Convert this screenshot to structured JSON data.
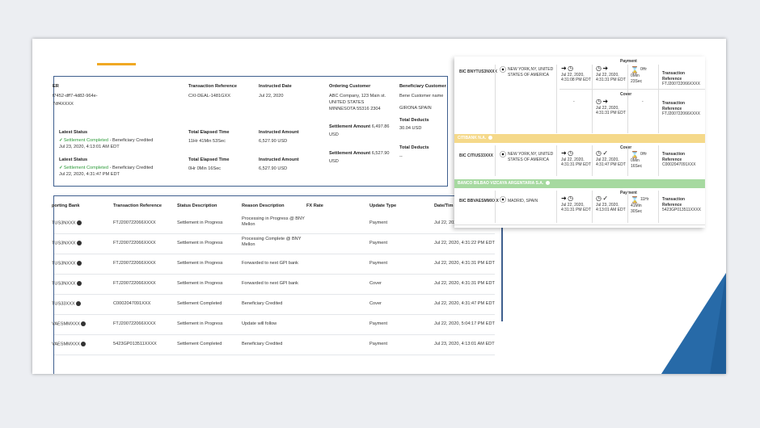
{
  "summary": {
    "ref_label_partial": "ER",
    "ref_value_1": "f7452-dff7-4d82-964e-",
    "ref_value_2": "7df4XXXX",
    "txn_ref_label": "Transaction Reference",
    "txn_ref_value": "CXI-DEAL-1481GXX",
    "instructed_date_label": "Instructed Date",
    "instructed_date_value": "Jul 22, 2020",
    "ordering_label": "Ordering Customer",
    "ordering_line1": "ABC Company, 123 Main st.",
    "ordering_line2": "UNITED STATES",
    "ordering_line3": "MINNESOTA 55316 2304",
    "beneficiary_label": "Beneficiary Customer",
    "beneficiary_line1": "Bene Customer name",
    "beneficiary_line2": "GIRONA SPAIN",
    "status1_label": "Latest Status",
    "status1_text": "Settlement Completed",
    "status1_suffix": " - Beneficiary Credited",
    "status1_date": "Jul 23, 2020, 4:13:01 AM EDT",
    "elapsed1_label": "Total Elapsed Time",
    "elapsed1_value": "11Hr 41Min 53Sec",
    "amount1_label": "Instructed Amount",
    "amount1_value": "6,527.90 USD",
    "settle1_label": "Settlement Amount",
    "settle1_value": "6,497.86",
    "settle1_ccy": "USD",
    "deducts1_label": "Total Deducts",
    "deducts1_value": "30.04 USD",
    "status2_label": "Latest Status",
    "status2_text": "Settlement Completed",
    "status2_suffix": " - Beneficiary Credited",
    "status2_date": "Jul 22, 2020, 4:31:47 PM EDT",
    "elapsed2_label": "Total Elapsed Time",
    "elapsed2_value": "0Hr 0Min 16Sec",
    "amount2_label": "Instructed Amount",
    "amount2_value": "6,527.90 USD",
    "settle2_label": "Settlement Amount",
    "settle2_value": "6,527.90",
    "settle2_ccy": "USD",
    "deducts2_label": "Total Deducts",
    "deducts2_value": "--"
  },
  "table": {
    "headers": [
      "porting Bank",
      "Transaction Reference",
      "Status Description",
      "Reason Description",
      "FX Rate",
      "Update Type",
      "Date/Tim"
    ],
    "rows": [
      {
        "bank": "TUS3NXXX",
        "ref": "FTJ200722066XXXX",
        "status": "Settlement in Progress",
        "reason1": "Processing in Progress @ BNY",
        "reason2": "Mellon",
        "type": "Payment",
        "date": "Jul 22, 2020,"
      },
      {
        "bank": "TUS3NXXX",
        "ref": "FTJ200722066XXXX",
        "status": "Settlement in Progress",
        "reason1": "Processing Complete @ BNY",
        "reason2": "Mellon",
        "type": "Payment",
        "date": "Jul 22, 2020, 4:31:22 PM EDT"
      },
      {
        "bank": "TUS3NXXX",
        "ref": "FTJ200722066XXXX",
        "status": "Settlement in Progress",
        "reason1": "Forwarded to next GPI bank",
        "reason2": "",
        "type": "Payment",
        "date": "Jul 22, 2020, 4:31:31 PM EDT"
      },
      {
        "bank": "TUS3NXXX",
        "ref": "FTJ200722066XXXX",
        "status": "Settlement in Progress",
        "reason1": "Forwarded to next GPI bank",
        "reason2": "",
        "type": "Cover",
        "date": "Jul 22, 2020, 4:31:31 PM EDT"
      },
      {
        "bank": "TUS33XXX",
        "ref": "C0002047091XXX",
        "status": "Settlement Completed",
        "reason1": "Beneficiary Credited",
        "reason2": "",
        "type": "Cover",
        "date": "Jul 22, 2020, 4:31:47 PM EDT"
      },
      {
        "bank": "VAESMMXXX",
        "ref": "FTJ200722066XXXX",
        "status": "Settlement in Progress",
        "reason1": "Update will follow",
        "reason2": "",
        "type": "Payment",
        "date": "Jul 22, 2020, 5:04:17 PM EDT"
      },
      {
        "bank": "VAESMMXXX",
        "ref": "5423GP013511XXXX",
        "status": "Settlement Completed",
        "reason1": "Beneficiary Credited",
        "reason2": "",
        "type": "Payment",
        "date": "Jul 23, 2020, 4:13:01 AM EDT"
      }
    ]
  },
  "tracker": {
    "top_payment_label": "Payment",
    "b1_bic": "BIC BNYTUS3NXXX",
    "b1_city1": "NEW YORK,NY, UNITED",
    "b1_city2": "STATES OF AMERICA",
    "b1_r1_date": "Jul 22, 2020,",
    "b1_r1_time": "4:31:08 PM EDT",
    "b1_r1_date2": "Jul 22, 2020,",
    "b1_r1_time2": "4:31:31 PM EDT",
    "b1_r1_elapsed1": "0Hr 0Min",
    "b1_r1_elapsed2": "23Sec",
    "b1_ref_label": "Transaction Reference",
    "b1_ref_value": "FTJ200722066XXXX",
    "cover_label": "Cover",
    "dash": "-",
    "b1_r2_date": "Jul 22, 2020,",
    "b1_r2_time": "4:31:31 PM EDT",
    "b1_r2_ref_label": "Transaction Reference",
    "b1_r2_ref_value": "FTJ200722066XXXX",
    "band1": "CITIBANK N.A.",
    "b2_cover_label": "Cover",
    "b2_bic": "BIC CITIUS33XXX",
    "b2_city1": "NEW YORK,NY, UNITED",
    "b2_city2": "STATES OF AMERICA",
    "b2_date1": "Jul 22, 2020,",
    "b2_time1": "4:31:31 PM EDT",
    "b2_date2": "Jul 22, 2020,",
    "b2_time2": "4:31:47 PM EDT",
    "b2_elapsed1": "0Hr 0Min",
    "b2_elapsed2": "16Sec",
    "b2_ref_label": "Transaction Reference",
    "b2_ref_value": "C0002047091XXX",
    "band2": "BANCO BILBAO VIZCAYA ARGENTARIA S.A.",
    "b3_payment_label": "Payment",
    "b3_bic": "BIC BBVAESMMXXX",
    "b3_city": "MADRID, SPAIN",
    "b3_date1": "Jul 22, 2020,",
    "b3_time1": "4:31:31 PM EDT",
    "b3_date2": "Jul 23, 2020,",
    "b3_time2": "4:13:01 AM EDT",
    "b3_elapsed1": "11Hr 41Min",
    "b3_elapsed2": "30Sec",
    "b3_ref_label": "Transaction Reference",
    "b3_ref_value": "5423GP013511XXXX"
  },
  "colors": {
    "accent_blue": "#3f5f8e",
    "orange": "#f0a823",
    "green": "#2e9b3a",
    "band_yellow": "#f5d98a",
    "band_green": "#a6d9a0",
    "deep_blue": "#1f5e99"
  }
}
